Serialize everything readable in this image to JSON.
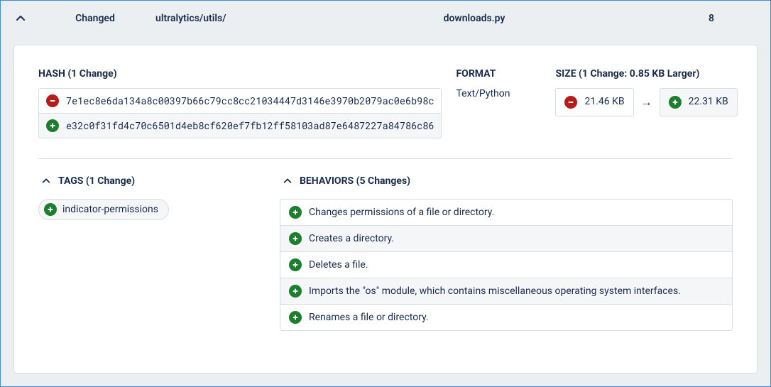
{
  "header": {
    "status": "Changed",
    "path": "ultralytics/utils/",
    "filename": "downloads.py",
    "change_count": "8"
  },
  "hash": {
    "title": "HASH (1 Change)",
    "old": "7e1ec8e6da134a8c00397b66c79cc8cc21034447d3146e3970b2079ac0e6b98c",
    "new": "e32c0f31fd4c70c6501d4eb8cf620ef7fb12ff58103ad87e6487227a84786c86"
  },
  "format": {
    "title": "FORMAT",
    "value": "Text/Python"
  },
  "size": {
    "title": "SIZE (1 Change: 0.85 KB Larger)",
    "old": "21.46 KB",
    "new": "22.31 KB"
  },
  "tags": {
    "title": "TAGS (1 Change)",
    "items": [
      "indicator-permissions"
    ]
  },
  "behaviors": {
    "title": "BEHAVIORS (5 Changes)",
    "items": [
      "Changes permissions of a file or directory.",
      "Creates a directory.",
      "Deletes a file.",
      "Imports the \"os\" module, which contains miscellaneous operating system interfaces.",
      "Renames a file or directory."
    ]
  }
}
